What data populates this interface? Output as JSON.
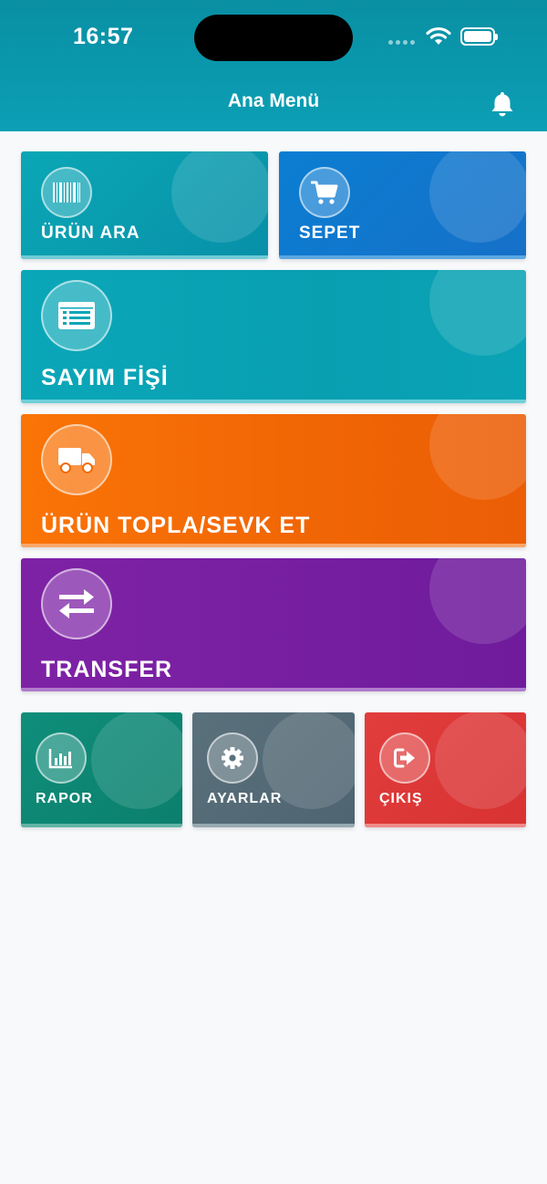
{
  "status_bar": {
    "time": "16:57"
  },
  "header": {
    "title": "Ana Menü"
  },
  "menu": {
    "urun_ara": {
      "label": "ÜRÜN ARA",
      "color": "#0a9fb2"
    },
    "sepet": {
      "label": "SEPET",
      "color": "#1485d4"
    },
    "sayim_fisi": {
      "label": "SAYIM FİŞİ",
      "color": "#0aa6b8"
    },
    "urun_topla": {
      "label": "ÜRÜN TOPLA/SEVK ET",
      "color": "#f26a06"
    },
    "transfer": {
      "label": "TRANSFER",
      "color": "#7b1fa2"
    },
    "rapor": {
      "label": "RAPOR",
      "color": "#0e8a76"
    },
    "ayarlar": {
      "label": "AYARLAR",
      "color": "#546e7a"
    },
    "cikis": {
      "label": "ÇIKIŞ",
      "color": "#e03a3a"
    }
  },
  "icons": [
    "barcode-icon",
    "cart-icon",
    "list-icon",
    "truck-icon",
    "transfer-icon",
    "chart-icon",
    "gear-icon",
    "logout-icon",
    "bell-icon",
    "wifi-icon"
  ]
}
